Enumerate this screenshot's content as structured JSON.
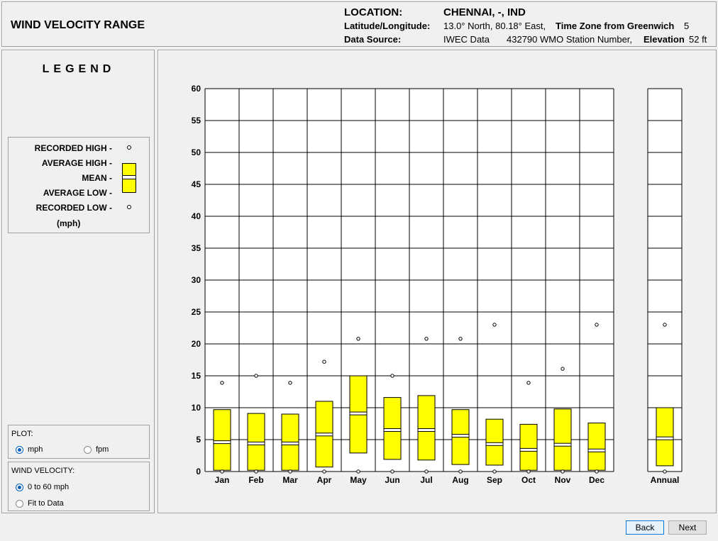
{
  "header": {
    "title": "WIND VELOCITY RANGE",
    "location_label": "LOCATION:",
    "location_value": "CHENNAI, -, IND",
    "latlong_label": "Latitude/Longitude:",
    "latlong_value": "13.0° North, 80.18° East,",
    "timezone_label": "Time Zone from Greenwich",
    "timezone_value": "5",
    "source_label": "Data Source:",
    "source_value": "IWEC Data",
    "station_value": "432790 WMO Station Number,",
    "elevation_label": "Elevation",
    "elevation_value": "52 ft"
  },
  "legend": {
    "title": "LEGEND",
    "recorded_high": "RECORDED HIGH -",
    "average_high": "AVERAGE HIGH -",
    "mean": "MEAN -",
    "average_low": "AVERAGE LOW -",
    "recorded_low": "RECORDED LOW -",
    "units": "(mph)",
    "box_color": "#ffff00"
  },
  "plot": {
    "title": "PLOT:",
    "options": [
      "mph",
      "fpm"
    ],
    "selected": "mph"
  },
  "wind_velocity": {
    "title": "WIND VELOCITY:",
    "options": [
      "0 to 60 mph",
      "Fit to Data"
    ],
    "selected": "0 to 60 mph"
  },
  "buttons": {
    "back": "Back",
    "next": "Next"
  },
  "chart_data": {
    "type": "boxplot",
    "ylim": [
      0,
      60
    ],
    "yticks": [
      0,
      5,
      10,
      15,
      20,
      25,
      30,
      35,
      40,
      45,
      50,
      55,
      60
    ],
    "categories": [
      "Jan",
      "Feb",
      "Mar",
      "Apr",
      "May",
      "Jun",
      "Jul",
      "Aug",
      "Sep",
      "Oct",
      "Nov",
      "Dec"
    ],
    "recorded_high": [
      13.9,
      15.0,
      13.9,
      17.2,
      20.8,
      15.0,
      20.8,
      20.8,
      23.0,
      13.9,
      16.1,
      23.0
    ],
    "average_high": [
      9.7,
      9.1,
      9.0,
      11.0,
      15.0,
      11.6,
      11.9,
      9.7,
      8.2,
      7.4,
      9.8,
      7.6
    ],
    "mean": [
      4.6,
      4.4,
      4.4,
      5.8,
      9.1,
      6.5,
      6.5,
      5.6,
      4.3,
      3.4,
      4.2,
      3.3
    ],
    "average_low": [
      0.2,
      0.2,
      0.2,
      0.7,
      2.9,
      1.9,
      1.8,
      1.1,
      1.0,
      0.2,
      0.2,
      0.2
    ],
    "recorded_low": [
      0,
      0,
      0,
      0,
      0,
      0,
      0,
      0,
      0,
      0,
      0,
      0
    ],
    "annual": {
      "label": "Annual",
      "recorded_high": 23.0,
      "average_high": 10.0,
      "mean": 5.2,
      "average_low": 0.9,
      "recorded_low": 0
    }
  }
}
